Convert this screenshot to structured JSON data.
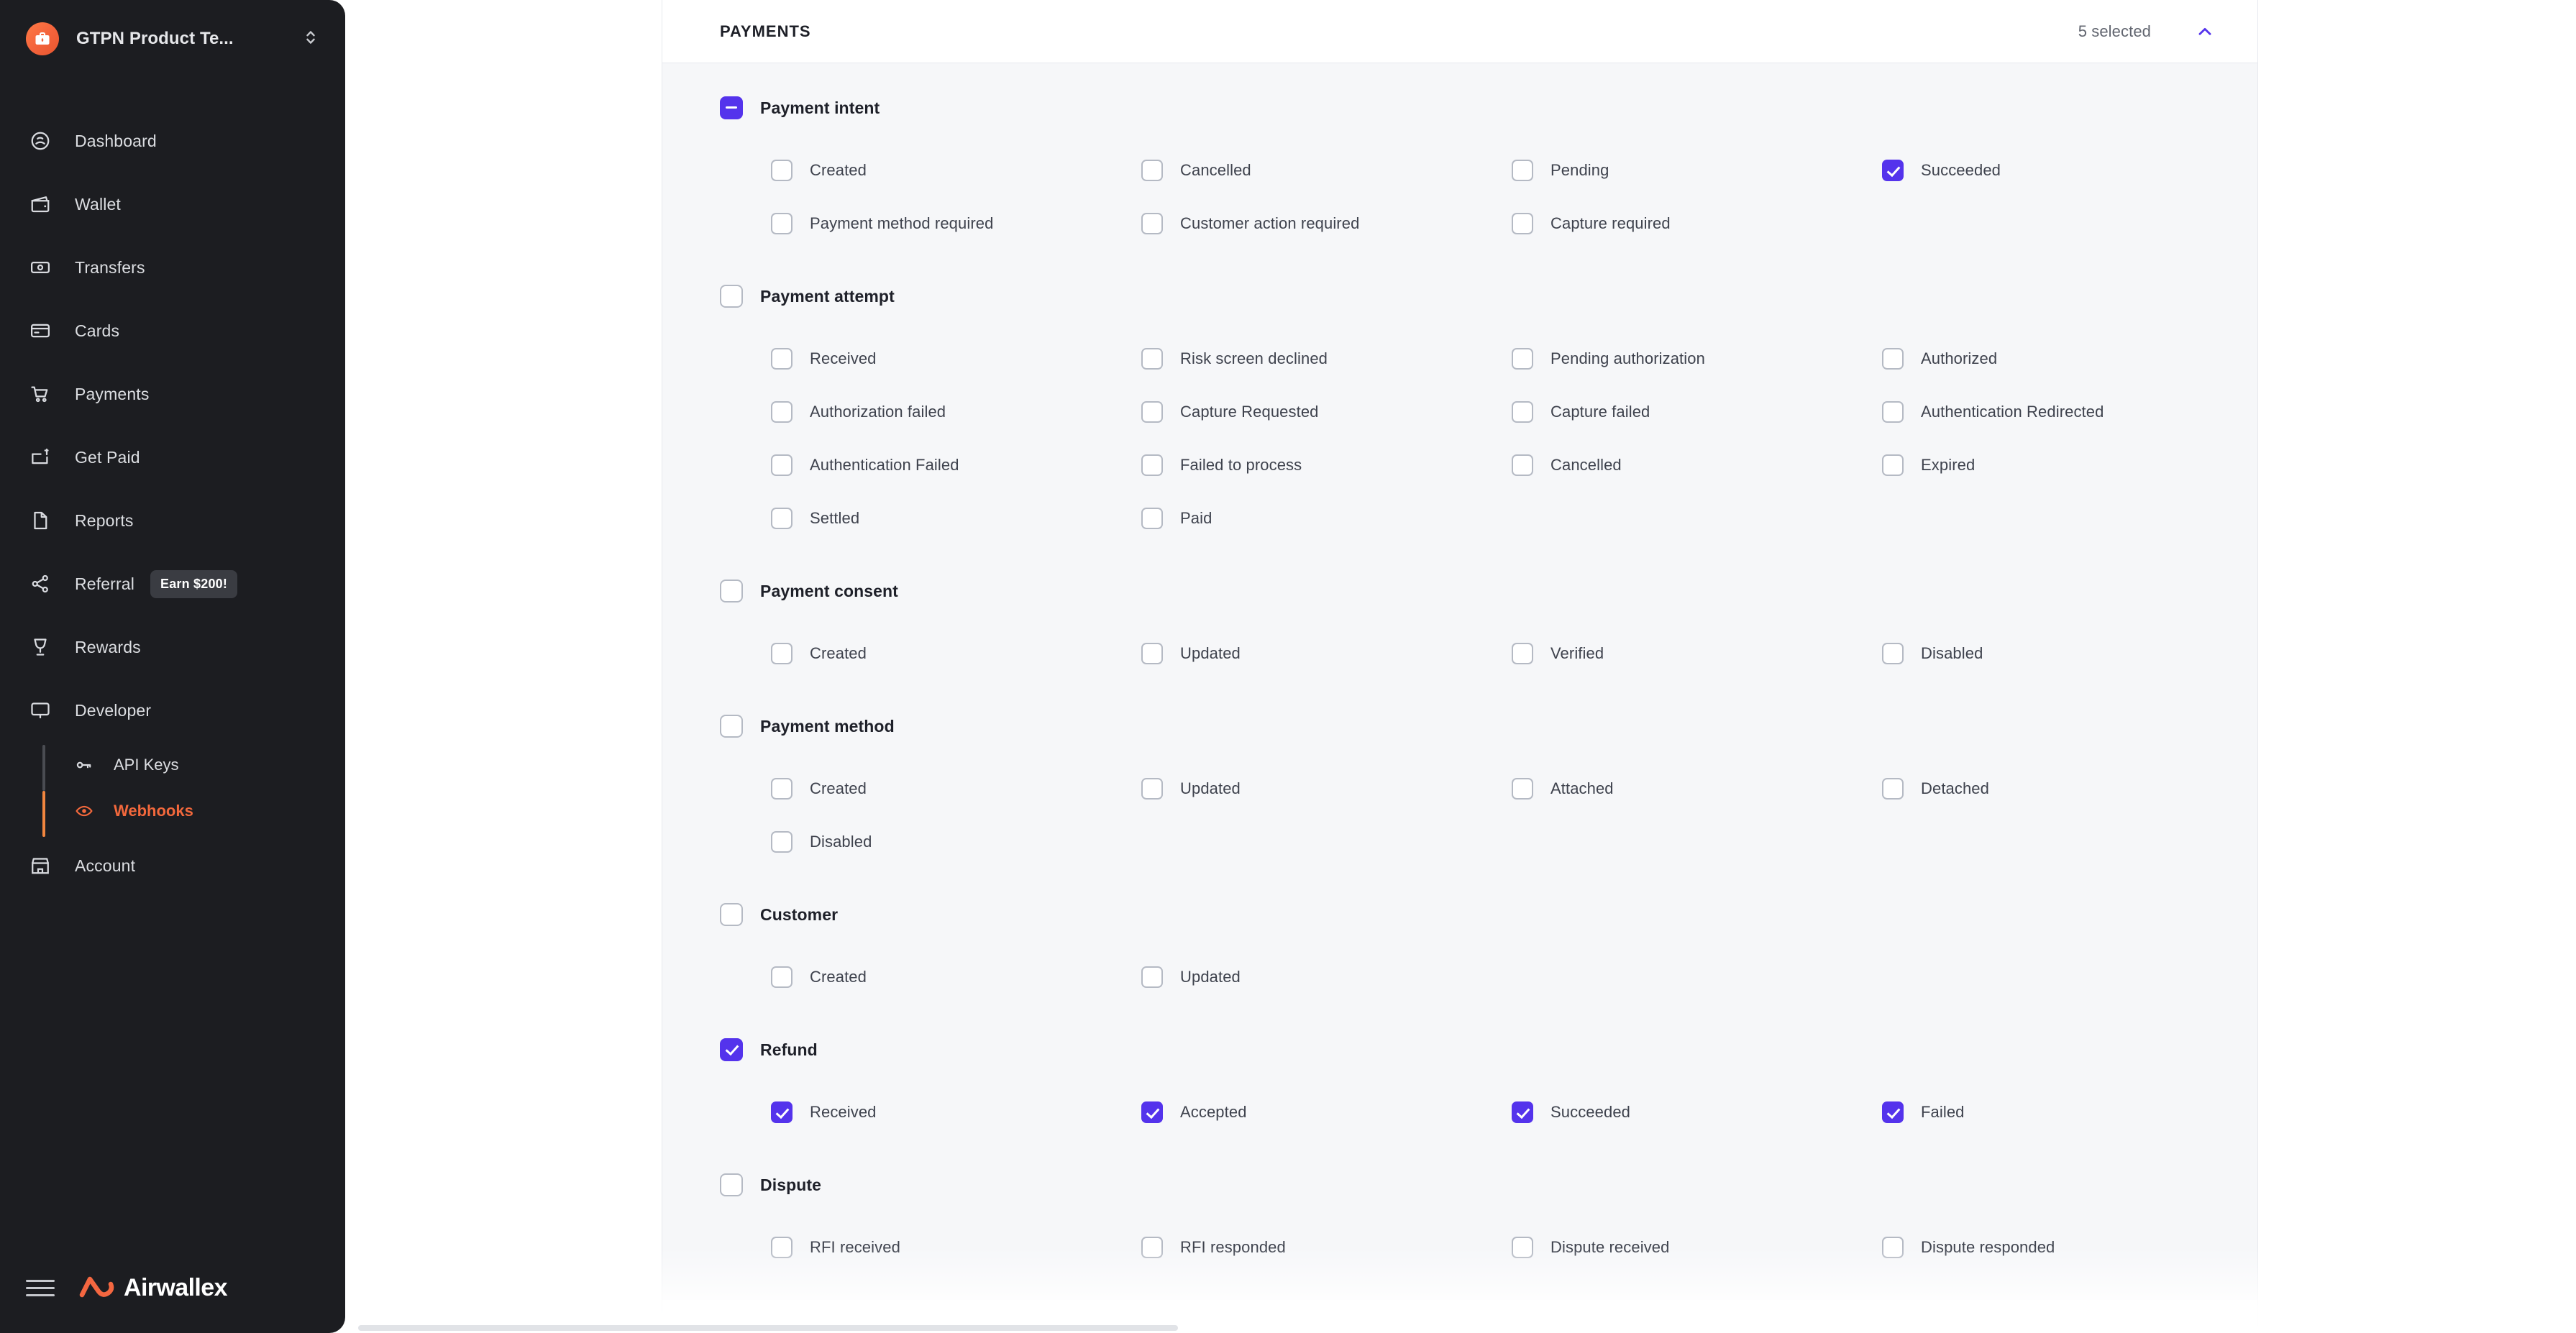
{
  "sidebar": {
    "org": {
      "name": "GTPN Product Te...",
      "logo_icon": "briefcase-icon",
      "switcher_icon": "chevron-up-down-icon"
    },
    "items": [
      {
        "label": "Dashboard",
        "icon": "dashboard-gauge-icon"
      },
      {
        "label": "Wallet",
        "icon": "wallet-icon"
      },
      {
        "label": "Transfers",
        "icon": "banknote-icon"
      },
      {
        "label": "Cards",
        "icon": "card-icon"
      },
      {
        "label": "Payments",
        "icon": "shopping-cart-icon"
      },
      {
        "label": "Get Paid",
        "icon": "invoice-dollar-icon"
      },
      {
        "label": "Reports",
        "icon": "document-icon"
      },
      {
        "label": "Referral",
        "icon": "share-nodes-icon",
        "badge": "Earn $200!"
      },
      {
        "label": "Rewards",
        "icon": "trophy-icon"
      },
      {
        "label": "Developer",
        "icon": "monitor-icon"
      }
    ],
    "sub_items": [
      {
        "label": "API Keys",
        "icon": "key-icon",
        "active": false
      },
      {
        "label": "Webhooks",
        "icon": "eye-icon",
        "active": true
      }
    ],
    "account": {
      "label": "Account",
      "icon": "storefront-icon"
    },
    "brand": {
      "name": "Airwallex",
      "menu_icon": "hamburger-icon",
      "logo_icon": "airwallex-logo-icon"
    }
  },
  "colors": {
    "sidebar_bg": "#1c1d21",
    "accent_purple": "#5433ec",
    "brand_orange": "#f2683c",
    "panel_bg": "#f6f7f9",
    "border": "#e7e9ee"
  },
  "panel": {
    "title": "PAYMENTS",
    "selected_label": "5 selected",
    "collapse_icon": "chevron-up-icon"
  },
  "groups": [
    {
      "name": "Payment intent",
      "state": "indeterminate",
      "options": [
        {
          "label": "Created",
          "checked": false
        },
        {
          "label": "Cancelled",
          "checked": false
        },
        {
          "label": "Pending",
          "checked": false
        },
        {
          "label": "Succeeded",
          "checked": true
        },
        {
          "label": "Payment method required",
          "checked": false
        },
        {
          "label": "Customer action required",
          "checked": false
        },
        {
          "label": "Capture required",
          "checked": false
        }
      ]
    },
    {
      "name": "Payment attempt",
      "state": "unchecked",
      "options": [
        {
          "label": "Received",
          "checked": false
        },
        {
          "label": "Risk screen declined",
          "checked": false
        },
        {
          "label": "Pending authorization",
          "checked": false
        },
        {
          "label": "Authorized",
          "checked": false
        },
        {
          "label": "Authorization failed",
          "checked": false
        },
        {
          "label": "Capture Requested",
          "checked": false
        },
        {
          "label": "Capture failed",
          "checked": false
        },
        {
          "label": "Authentication Redirected",
          "checked": false
        },
        {
          "label": "Authentication Failed",
          "checked": false
        },
        {
          "label": "Failed to process",
          "checked": false
        },
        {
          "label": "Cancelled",
          "checked": false
        },
        {
          "label": "Expired",
          "checked": false
        },
        {
          "label": "Settled",
          "checked": false
        },
        {
          "label": "Paid",
          "checked": false
        }
      ]
    },
    {
      "name": "Payment consent",
      "state": "unchecked",
      "options": [
        {
          "label": "Created",
          "checked": false
        },
        {
          "label": "Updated",
          "checked": false
        },
        {
          "label": "Verified",
          "checked": false
        },
        {
          "label": "Disabled",
          "checked": false
        }
      ]
    },
    {
      "name": "Payment method",
      "state": "unchecked",
      "options": [
        {
          "label": "Created",
          "checked": false
        },
        {
          "label": "Updated",
          "checked": false
        },
        {
          "label": "Attached",
          "checked": false
        },
        {
          "label": "Detached",
          "checked": false
        },
        {
          "label": "Disabled",
          "checked": false
        }
      ]
    },
    {
      "name": "Customer",
      "state": "unchecked",
      "options": [
        {
          "label": "Created",
          "checked": false
        },
        {
          "label": "Updated",
          "checked": false
        }
      ]
    },
    {
      "name": "Refund",
      "state": "checked",
      "options": [
        {
          "label": "Received",
          "checked": true
        },
        {
          "label": "Accepted",
          "checked": true
        },
        {
          "label": "Succeeded",
          "checked": true
        },
        {
          "label": "Failed",
          "checked": true
        }
      ]
    },
    {
      "name": "Dispute",
      "state": "unchecked",
      "options": [
        {
          "label": "RFI received",
          "checked": false
        },
        {
          "label": "RFI responded",
          "checked": false
        },
        {
          "label": "Dispute received",
          "checked": false
        },
        {
          "label": "Dispute responded",
          "checked": false
        }
      ]
    }
  ]
}
